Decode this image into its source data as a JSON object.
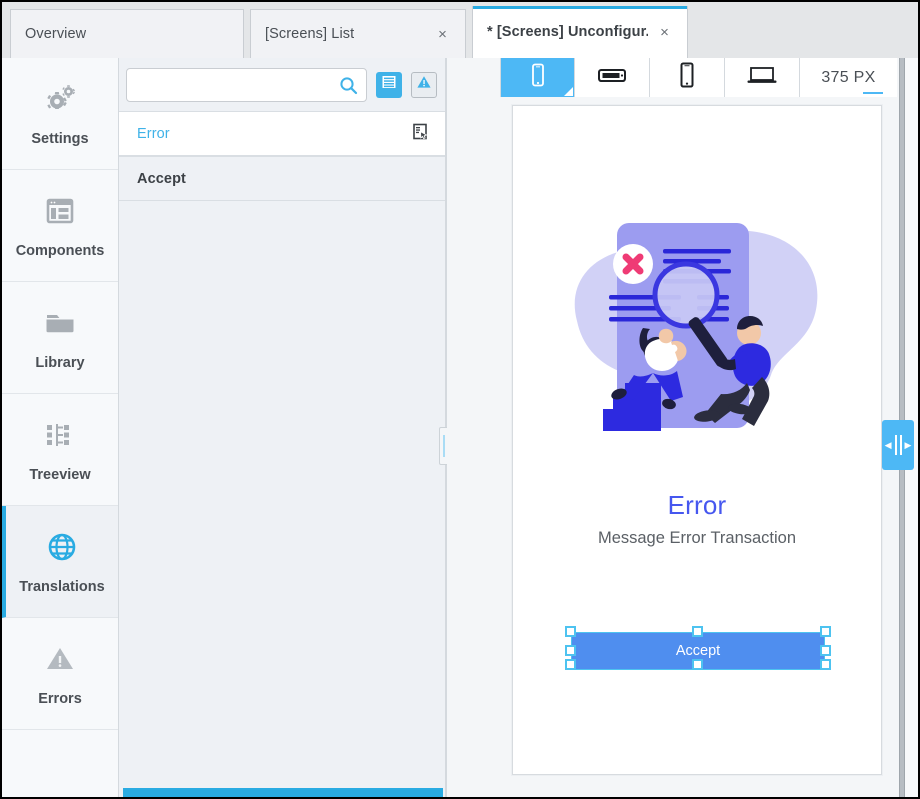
{
  "window": {
    "tabs": [
      {
        "label": "Overview",
        "closable": false,
        "active": false
      },
      {
        "label": "[Screens] List",
        "closable": true,
        "active": false,
        "close_label": "×"
      },
      {
        "label": "* [Screens] Unconfigur...",
        "closable": true,
        "active": true,
        "close_label": "×"
      }
    ]
  },
  "sidebar": {
    "items": [
      {
        "label": "Settings",
        "icon": "gears-icon",
        "active": false
      },
      {
        "label": "Components",
        "icon": "window-layout-icon",
        "active": false
      },
      {
        "label": "Library",
        "icon": "folder-icon",
        "active": false
      },
      {
        "label": "Treeview",
        "icon": "tree-hierarchy-icon",
        "active": false
      },
      {
        "label": "Translations",
        "icon": "globe-icon",
        "active": true
      },
      {
        "label": "Errors",
        "icon": "warning-triangle-icon",
        "active": false
      }
    ]
  },
  "list_panel": {
    "search": {
      "value": "",
      "placeholder": "",
      "icon": "search-icon"
    },
    "toolbar": [
      {
        "name": "list-view-button",
        "icon": "list-lines-icon",
        "style": "filled"
      },
      {
        "name": "errors-filter-button",
        "icon": "warning-triangle-icon",
        "style": "outlined"
      }
    ],
    "rows": [
      {
        "label": "Error",
        "selected": true,
        "trailing_icon": "screen-pointer-icon"
      },
      {
        "label": "Accept",
        "selected": false,
        "trailing_icon": ""
      }
    ]
  },
  "canvas": {
    "device_buttons": [
      {
        "name": "device-phone-portrait",
        "icon": "phone-portrait-icon",
        "active": true
      },
      {
        "name": "device-phone-landscape",
        "icon": "phone-landscape-icon",
        "active": false
      },
      {
        "name": "device-tablet",
        "icon": "tablet-icon",
        "active": false
      },
      {
        "name": "device-laptop",
        "icon": "laptop-icon",
        "active": false
      }
    ],
    "width_field": {
      "value": "375 PX"
    },
    "preview": {
      "illustration": "error-search-illustration",
      "title": "Error",
      "subtitle": "Message Error Transaction",
      "button": {
        "label": "Accept",
        "selected": true
      }
    }
  },
  "colors": {
    "accent_blue": "#29abe2",
    "device_active": "#4db8f5",
    "error_title": "#4657ef",
    "accept_button": "#4f8eef",
    "selection_handle": "#4dc3f0",
    "scrollbar": "#29abe2"
  },
  "right_edge": {
    "collapse_handle": {
      "name": "panel-collapse-handle",
      "icon": "expand-collapse-icon"
    }
  },
  "splitter": {
    "name": "panel-splitter-handle",
    "icon": "grip-vertical-icon"
  }
}
